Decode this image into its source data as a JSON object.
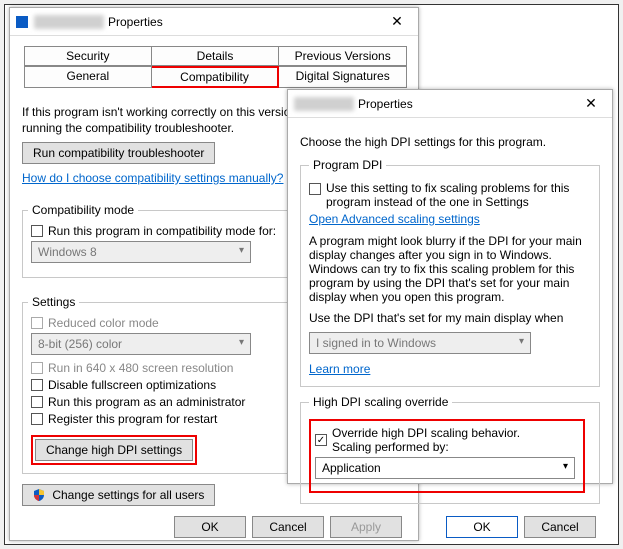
{
  "main": {
    "title_suffix": "Properties",
    "tabs_top": [
      "Security",
      "Details",
      "Previous Versions"
    ],
    "tabs_bot": [
      "General",
      "Compatibility",
      "Digital Signatures"
    ],
    "intro": "If this program isn't working correctly on this version of Windows, try running the compatibility troubleshooter.",
    "run_troubleshooter": "Run compatibility troubleshooter",
    "manual_link": "How do I choose compatibility settings manually?",
    "compat_mode_title": "Compatibility mode",
    "compat_mode_check": "Run this program in compatibility mode for:",
    "compat_mode_value": "Windows 8",
    "settings_title": "Settings",
    "reduced_color": "Reduced color mode",
    "color_value": "8-bit (256) color",
    "run_640": "Run in 640 x 480 screen resolution",
    "disable_fullscreen": "Disable fullscreen optimizations",
    "run_admin": "Run this program as an administrator",
    "register_restart": "Register this program for restart",
    "change_dpi": "Change high DPI settings",
    "change_all_users": "Change settings for all users",
    "ok": "OK",
    "cancel": "Cancel",
    "apply": "Apply"
  },
  "dpi": {
    "title_suffix": "Properties",
    "intro": "Choose the high DPI settings for this program.",
    "program_dpi_legend": "Program DPI",
    "use_setting": "Use this setting to fix scaling problems for this program instead of the one in Settings",
    "open_advanced": "Open Advanced scaling settings",
    "blurry_text": "A program might look blurry if the DPI for your main display changes after you sign in to Windows. Windows can try to fix this scaling problem for this program by using the DPI that's set for your main display when you open this program.",
    "use_dpi_when": "Use the DPI that's set for my main display when",
    "signed_in": "I signed in to Windows",
    "learn_more": "Learn more",
    "override_legend": "High DPI scaling override",
    "override_check": "Override high DPI scaling behavior.",
    "performed_by": "Scaling performed by:",
    "application": "Application",
    "ok": "OK",
    "cancel": "Cancel"
  }
}
